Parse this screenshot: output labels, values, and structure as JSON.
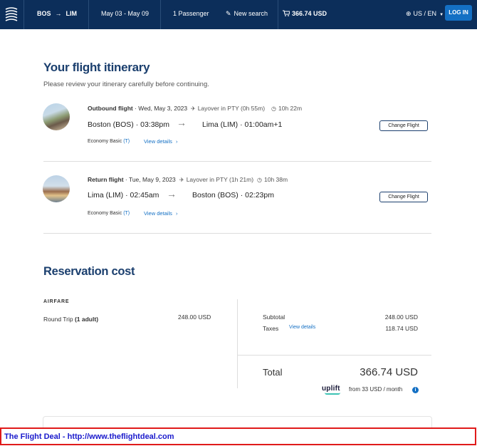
{
  "header": {
    "route_from": "BOS",
    "route_arrow": "→",
    "route_to": "LIM",
    "dates": "May 03 - May 09",
    "passengers": "1 Passenger",
    "new_search": "New search",
    "cart_price": "366.74 USD",
    "language": "US / EN",
    "login": "LOG IN"
  },
  "itinerary": {
    "title": "Your flight itinerary",
    "subtitle": "Please review your itinerary carefully before continuing.",
    "flights": [
      {
        "label": "Outbound flight",
        "date": "· Wed, May 3, 2023",
        "layover": "Layover in PTY (0h 55m)",
        "duration": "10h 22m",
        "origin": "Boston (BOS) · 03:38pm",
        "destination": "Lima (LIM) · 01:00am+1",
        "fare_class": "Economy Basic",
        "fare_code": "(T)",
        "details_link": "View details",
        "change_button": "Change Flight"
      },
      {
        "label": "Return flight",
        "date": "· Tue, May 9, 2023",
        "layover": "Layover in PTY (1h 21m)",
        "duration": "10h 38m",
        "origin": "Lima (LIM) · 02:45am",
        "destination": "Boston (BOS) · 02:23pm",
        "fare_class": "Economy Basic",
        "fare_code": "(T)",
        "details_link": "View details",
        "change_button": "Change Flight"
      }
    ]
  },
  "cost": {
    "title": "Reservation cost",
    "section_label": "AIRFARE",
    "trip_type": "Round Trip",
    "trip_pax": "(1 adult)",
    "trip_price": "248.00 USD",
    "subtotal_label": "Subtotal",
    "subtotal_value": "248.00 USD",
    "taxes_label": "Taxes",
    "taxes_link": "View details",
    "taxes_value": "118.74 USD",
    "total_label": "Total",
    "total_value": "366.74 USD",
    "uplift_brand": "uplift",
    "uplift_text": "from 33 USD  / month",
    "info_glyph": "i"
  },
  "banner": {
    "text": "The Flight Deal - http://www.theflightdeal.com",
    "border_color": "#e01a1a",
    "text_color": "#1a1acc"
  },
  "colors": {
    "header_bg": "#0c2e5a",
    "accent": "#1470c4",
    "heading": "#1b3f6e"
  }
}
